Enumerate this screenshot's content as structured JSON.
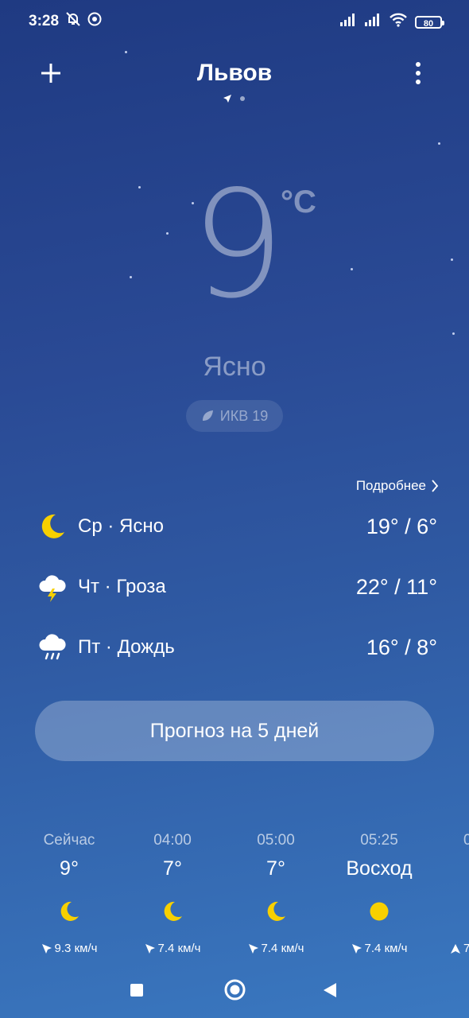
{
  "status": {
    "time": "3:28",
    "battery": "80"
  },
  "header": {
    "city": "Львов"
  },
  "current": {
    "temperature": "9",
    "unit": "°C",
    "condition": "Ясно",
    "aqi": "ИКВ 19"
  },
  "details_label": "Подробнее",
  "daily": [
    {
      "label": "Ср · Ясно",
      "range": "19° / 6°",
      "icon": "moon-icon"
    },
    {
      "label": "Чт · Гроза",
      "range": "22° / 11°",
      "icon": "thunderstorm-icon"
    },
    {
      "label": "Пт · Дождь",
      "range": "16° / 8°",
      "icon": "rain-icon"
    }
  ],
  "forecast_button": "Прогноз на 5 дней",
  "hourly": [
    {
      "time": "Сейчас",
      "temp": "9°",
      "icon": "moon-icon",
      "wind": "9.3 км/ч"
    },
    {
      "time": "04:00",
      "temp": "7°",
      "icon": "moon-icon",
      "wind": "7.4 км/ч"
    },
    {
      "time": "05:00",
      "temp": "7°",
      "icon": "moon-icon",
      "wind": "7.4 км/ч"
    },
    {
      "time": "05:25",
      "temp": "Восход",
      "icon": "sun-icon",
      "wind": "7.4 км/ч"
    },
    {
      "time": "0",
      "temp": "",
      "icon": "",
      "wind": "7"
    }
  ],
  "colors": {
    "accent_yellow": "#f7d000"
  }
}
